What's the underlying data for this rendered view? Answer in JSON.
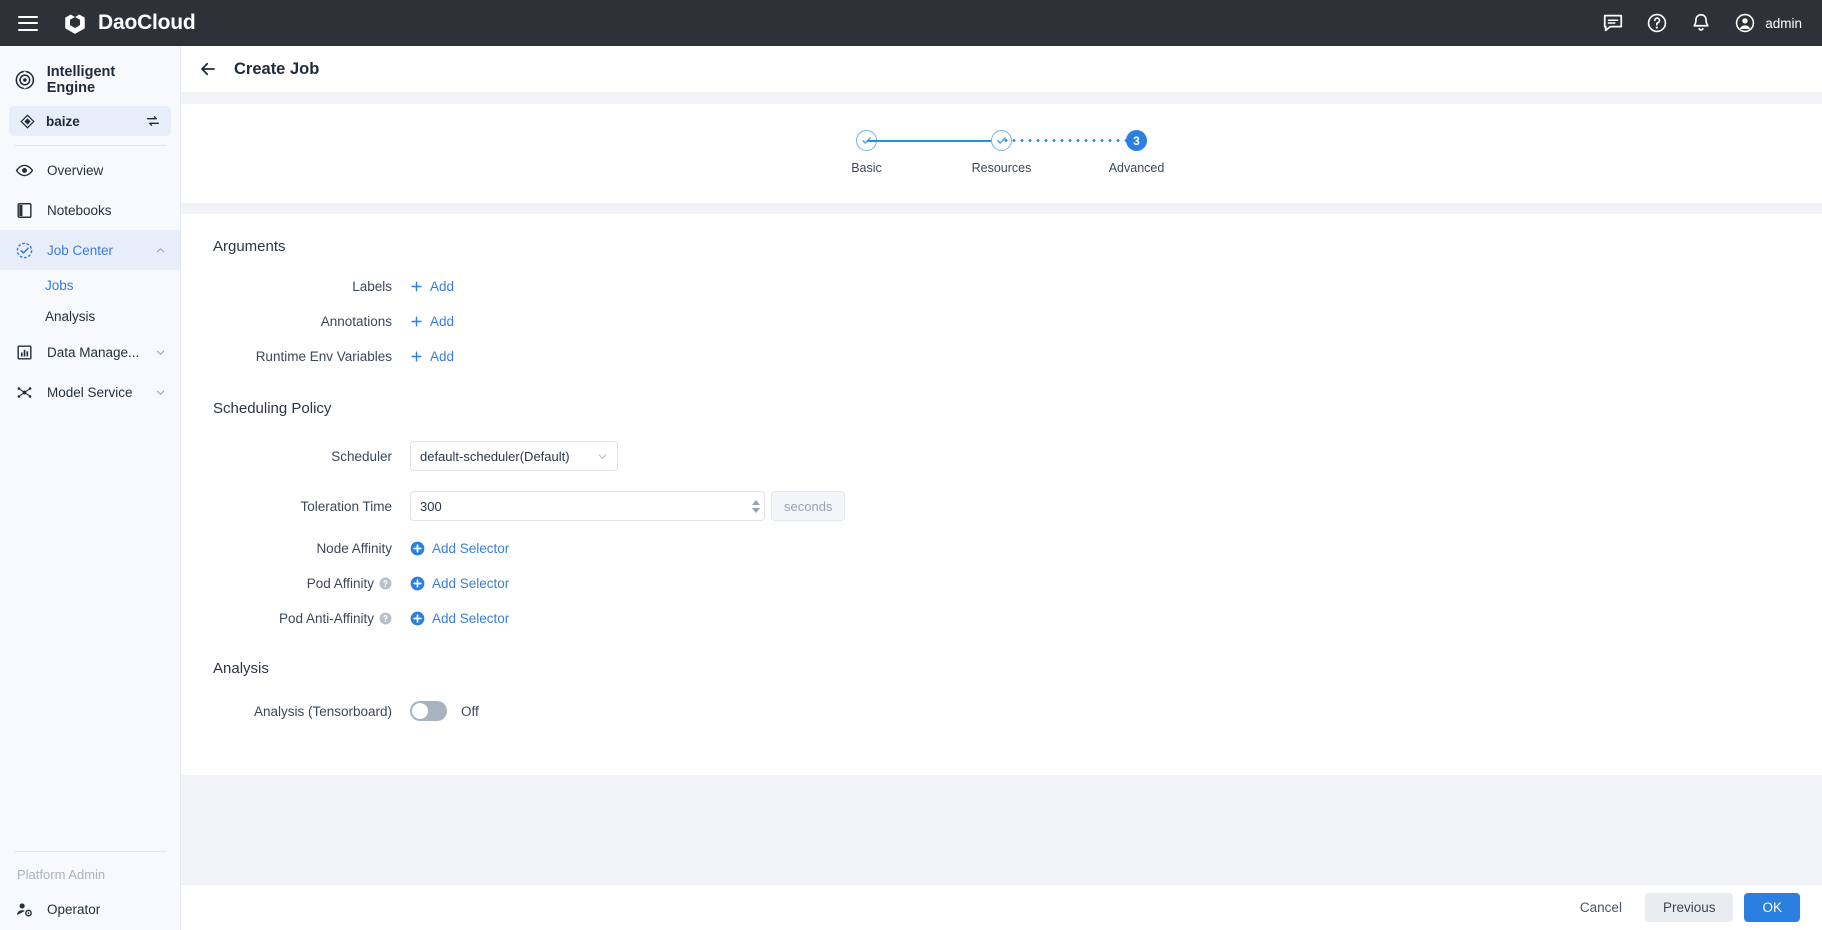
{
  "topbar": {
    "brand": "DaoCloud",
    "username": "admin",
    "icons": [
      "menu-icon",
      "chat-icon",
      "help-icon",
      "bell-icon",
      "user-avatar-icon"
    ]
  },
  "sidebar": {
    "product": "Intelligent Engine",
    "workspace": "baize",
    "items": [
      {
        "label": "Overview",
        "icon": "eye-icon",
        "active": false,
        "caret": false
      },
      {
        "label": "Notebooks",
        "icon": "book-icon",
        "active": false,
        "caret": false
      },
      {
        "label": "Job Center",
        "icon": "check-circle-icon",
        "active": true,
        "caret": "up"
      },
      {
        "label": "Data Manage...",
        "icon": "chart-box-icon",
        "active": false,
        "caret": "down"
      },
      {
        "label": "Model Service",
        "icon": "model-nodes-icon",
        "active": false,
        "caret": "down"
      }
    ],
    "subitems": [
      {
        "label": "Jobs",
        "active": true
      },
      {
        "label": "Analysis",
        "active": false
      }
    ],
    "bottom_section_title": "Platform Admin",
    "bottom_items": [
      {
        "label": "Operator",
        "icon": "user-gear-icon"
      }
    ]
  },
  "page": {
    "title": "Create Job",
    "back_icon": "arrow-left-icon"
  },
  "stepper": {
    "steps": [
      {
        "label": "Basic",
        "state": "done",
        "mark": "check"
      },
      {
        "label": "Resources",
        "state": "done",
        "mark": "check"
      },
      {
        "label": "Advanced",
        "state": "current",
        "mark": "3"
      }
    ],
    "connectors": [
      "solid",
      "dotted"
    ]
  },
  "form": {
    "arguments": {
      "title": "Arguments",
      "rows": [
        {
          "label": "Labels",
          "action": "Add",
          "icon": "plus-icon"
        },
        {
          "label": "Annotations",
          "action": "Add",
          "icon": "plus-icon"
        },
        {
          "label": "Runtime Env Variables",
          "action": "Add",
          "icon": "plus-icon"
        }
      ]
    },
    "scheduling": {
      "title": "Scheduling Policy",
      "scheduler": {
        "label": "Scheduler",
        "value": "default-scheduler(Default)"
      },
      "toleration": {
        "label": "Toleration Time",
        "value": "300",
        "unit": "seconds"
      },
      "affinity_rows": [
        {
          "label": "Node Affinity",
          "help": false,
          "action": "Add Selector"
        },
        {
          "label": "Pod Affinity",
          "help": true,
          "action": "Add Selector"
        },
        {
          "label": "Pod Anti-Affinity",
          "help": true,
          "action": "Add Selector"
        }
      ]
    },
    "analysis": {
      "title": "Analysis",
      "row": {
        "label": "Analysis (Tensorboard)",
        "state": "Off",
        "on": false
      }
    }
  },
  "footer": {
    "cancel": "Cancel",
    "previous": "Previous",
    "ok": "OK"
  },
  "colors": {
    "accent": "#2b7fe0",
    "link": "#3a7ddb",
    "topbar_bg": "#2e3238",
    "sidebar_bg": "#f7f9fc",
    "content_bg": "#f1f3f7",
    "active_nav_bg": "#e8eef9"
  }
}
